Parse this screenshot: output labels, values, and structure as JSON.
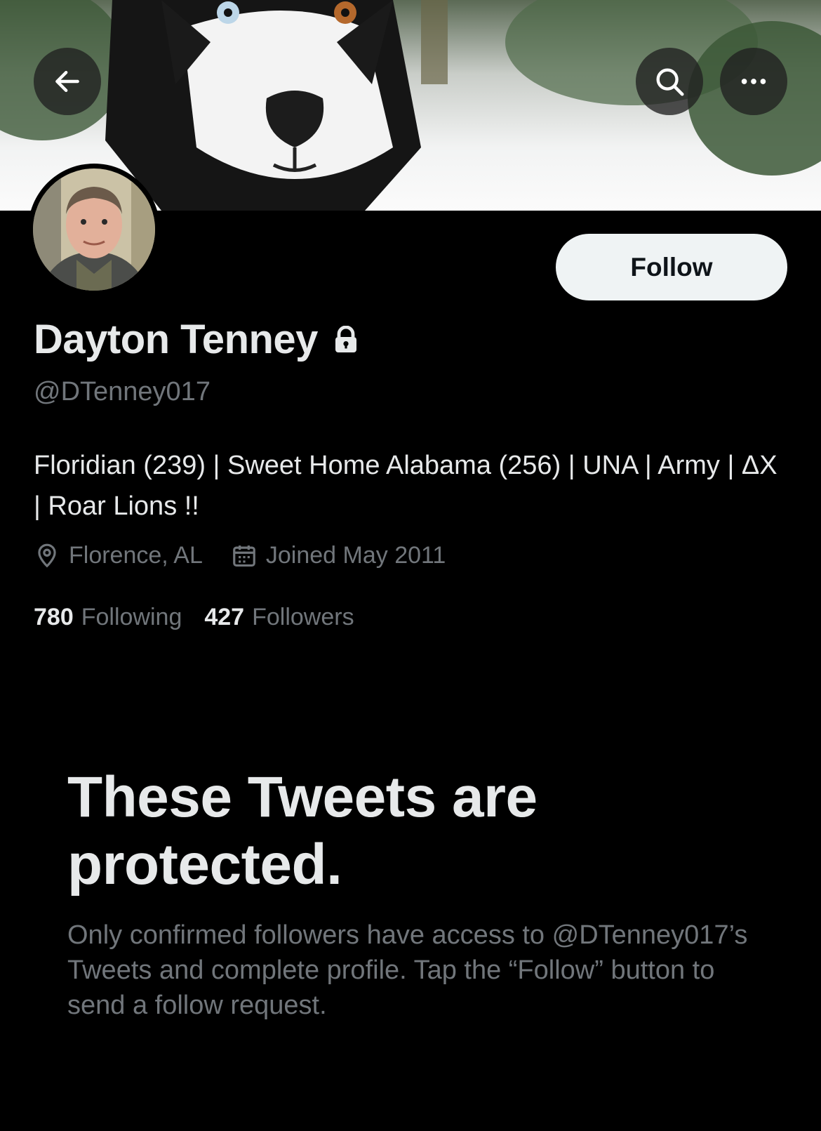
{
  "header": {
    "back_icon": "arrow-left-icon",
    "search_icon": "search-icon",
    "more_icon": "more-horizontal-icon"
  },
  "profile": {
    "display_name": "Dayton Tenney",
    "protected_icon": "lock-icon",
    "handle": "@DTenney017",
    "bio": "Floridian (239) | Sweet Home Alabama (256) | UNA | Army | ΔX | Roar Lions !!",
    "location": "Florence, AL",
    "location_icon": "location-pin-icon",
    "joined": "Joined May 2011",
    "joined_icon": "calendar-icon",
    "following_count": "780",
    "following_label": "Following",
    "followers_count": "427",
    "followers_label": "Followers",
    "follow_label": "Follow"
  },
  "protected_notice": {
    "title": "These Tweets are protected.",
    "body": "Only confirmed followers have access to @DTenney017’s Tweets and complete profile. Tap the “Follow” button to send a follow request."
  },
  "colors": {
    "background": "#000000",
    "primary_text": "#e7e9ea",
    "secondary_text": "#71767b",
    "follow_button_bg": "#eff3f4",
    "follow_button_text": "#0f1419"
  }
}
